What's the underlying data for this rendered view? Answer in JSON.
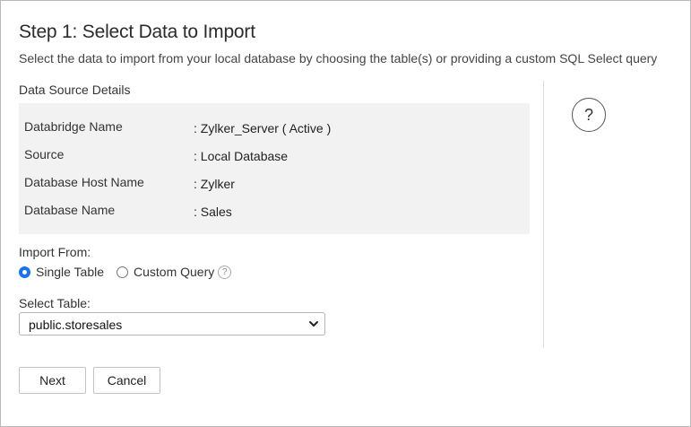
{
  "header": {
    "title": "Step 1: Select Data to Import",
    "subtitle": "Select the data to import from your local database by choosing the table(s) or providing a custom SQL Select query"
  },
  "details": {
    "heading": "Data Source Details",
    "rows": [
      {
        "label": "Databridge Name",
        "value": ": Zylker_Server ( Active )"
      },
      {
        "label": "Source",
        "value": ": Local Database"
      },
      {
        "label": "Database Host Name",
        "value": ": Zylker"
      },
      {
        "label": "Database Name",
        "value": ": Sales"
      }
    ]
  },
  "help": {
    "icon": "question-circle-icon",
    "glyph": "?"
  },
  "import_from": {
    "label": "Import From:",
    "options": [
      {
        "label": "Single Table",
        "selected": true
      },
      {
        "label": "Custom Query",
        "selected": false
      }
    ],
    "help_glyph": "?"
  },
  "select_table": {
    "label": "Select Table:",
    "value": "public.storesales"
  },
  "buttons": {
    "next": "Next",
    "cancel": "Cancel"
  },
  "colors": {
    "accent": "#1a73e8",
    "panel_bg": "#f2f2f2",
    "border": "#b9b9b9"
  }
}
